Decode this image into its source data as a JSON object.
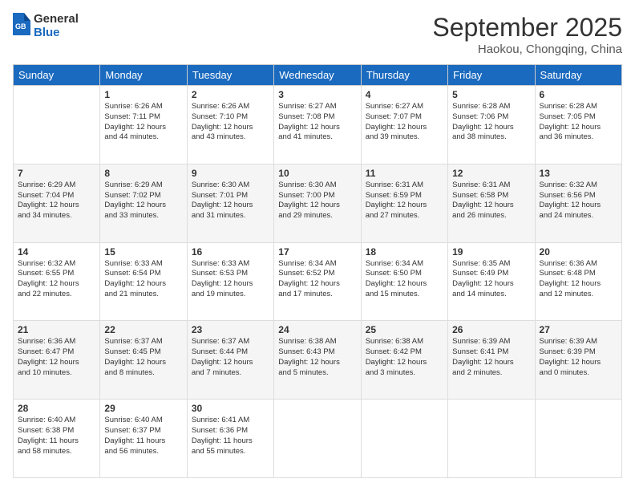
{
  "header": {
    "logo_line1": "General",
    "logo_line2": "Blue",
    "month": "September 2025",
    "location": "Haokou, Chongqing, China"
  },
  "days_of_week": [
    "Sunday",
    "Monday",
    "Tuesday",
    "Wednesday",
    "Thursday",
    "Friday",
    "Saturday"
  ],
  "weeks": [
    [
      {
        "num": "",
        "info": ""
      },
      {
        "num": "1",
        "info": "Sunrise: 6:26 AM\nSunset: 7:11 PM\nDaylight: 12 hours\nand 44 minutes."
      },
      {
        "num": "2",
        "info": "Sunrise: 6:26 AM\nSunset: 7:10 PM\nDaylight: 12 hours\nand 43 minutes."
      },
      {
        "num": "3",
        "info": "Sunrise: 6:27 AM\nSunset: 7:08 PM\nDaylight: 12 hours\nand 41 minutes."
      },
      {
        "num": "4",
        "info": "Sunrise: 6:27 AM\nSunset: 7:07 PM\nDaylight: 12 hours\nand 39 minutes."
      },
      {
        "num": "5",
        "info": "Sunrise: 6:28 AM\nSunset: 7:06 PM\nDaylight: 12 hours\nand 38 minutes."
      },
      {
        "num": "6",
        "info": "Sunrise: 6:28 AM\nSunset: 7:05 PM\nDaylight: 12 hours\nand 36 minutes."
      }
    ],
    [
      {
        "num": "7",
        "info": "Sunrise: 6:29 AM\nSunset: 7:04 PM\nDaylight: 12 hours\nand 34 minutes."
      },
      {
        "num": "8",
        "info": "Sunrise: 6:29 AM\nSunset: 7:02 PM\nDaylight: 12 hours\nand 33 minutes."
      },
      {
        "num": "9",
        "info": "Sunrise: 6:30 AM\nSunset: 7:01 PM\nDaylight: 12 hours\nand 31 minutes."
      },
      {
        "num": "10",
        "info": "Sunrise: 6:30 AM\nSunset: 7:00 PM\nDaylight: 12 hours\nand 29 minutes."
      },
      {
        "num": "11",
        "info": "Sunrise: 6:31 AM\nSunset: 6:59 PM\nDaylight: 12 hours\nand 27 minutes."
      },
      {
        "num": "12",
        "info": "Sunrise: 6:31 AM\nSunset: 6:58 PM\nDaylight: 12 hours\nand 26 minutes."
      },
      {
        "num": "13",
        "info": "Sunrise: 6:32 AM\nSunset: 6:56 PM\nDaylight: 12 hours\nand 24 minutes."
      }
    ],
    [
      {
        "num": "14",
        "info": "Sunrise: 6:32 AM\nSunset: 6:55 PM\nDaylight: 12 hours\nand 22 minutes."
      },
      {
        "num": "15",
        "info": "Sunrise: 6:33 AM\nSunset: 6:54 PM\nDaylight: 12 hours\nand 21 minutes."
      },
      {
        "num": "16",
        "info": "Sunrise: 6:33 AM\nSunset: 6:53 PM\nDaylight: 12 hours\nand 19 minutes."
      },
      {
        "num": "17",
        "info": "Sunrise: 6:34 AM\nSunset: 6:52 PM\nDaylight: 12 hours\nand 17 minutes."
      },
      {
        "num": "18",
        "info": "Sunrise: 6:34 AM\nSunset: 6:50 PM\nDaylight: 12 hours\nand 15 minutes."
      },
      {
        "num": "19",
        "info": "Sunrise: 6:35 AM\nSunset: 6:49 PM\nDaylight: 12 hours\nand 14 minutes."
      },
      {
        "num": "20",
        "info": "Sunrise: 6:36 AM\nSunset: 6:48 PM\nDaylight: 12 hours\nand 12 minutes."
      }
    ],
    [
      {
        "num": "21",
        "info": "Sunrise: 6:36 AM\nSunset: 6:47 PM\nDaylight: 12 hours\nand 10 minutes."
      },
      {
        "num": "22",
        "info": "Sunrise: 6:37 AM\nSunset: 6:45 PM\nDaylight: 12 hours\nand 8 minutes."
      },
      {
        "num": "23",
        "info": "Sunrise: 6:37 AM\nSunset: 6:44 PM\nDaylight: 12 hours\nand 7 minutes."
      },
      {
        "num": "24",
        "info": "Sunrise: 6:38 AM\nSunset: 6:43 PM\nDaylight: 12 hours\nand 5 minutes."
      },
      {
        "num": "25",
        "info": "Sunrise: 6:38 AM\nSunset: 6:42 PM\nDaylight: 12 hours\nand 3 minutes."
      },
      {
        "num": "26",
        "info": "Sunrise: 6:39 AM\nSunset: 6:41 PM\nDaylight: 12 hours\nand 2 minutes."
      },
      {
        "num": "27",
        "info": "Sunrise: 6:39 AM\nSunset: 6:39 PM\nDaylight: 12 hours\nand 0 minutes."
      }
    ],
    [
      {
        "num": "28",
        "info": "Sunrise: 6:40 AM\nSunset: 6:38 PM\nDaylight: 11 hours\nand 58 minutes."
      },
      {
        "num": "29",
        "info": "Sunrise: 6:40 AM\nSunset: 6:37 PM\nDaylight: 11 hours\nand 56 minutes."
      },
      {
        "num": "30",
        "info": "Sunrise: 6:41 AM\nSunset: 6:36 PM\nDaylight: 11 hours\nand 55 minutes."
      },
      {
        "num": "",
        "info": ""
      },
      {
        "num": "",
        "info": ""
      },
      {
        "num": "",
        "info": ""
      },
      {
        "num": "",
        "info": ""
      }
    ]
  ]
}
